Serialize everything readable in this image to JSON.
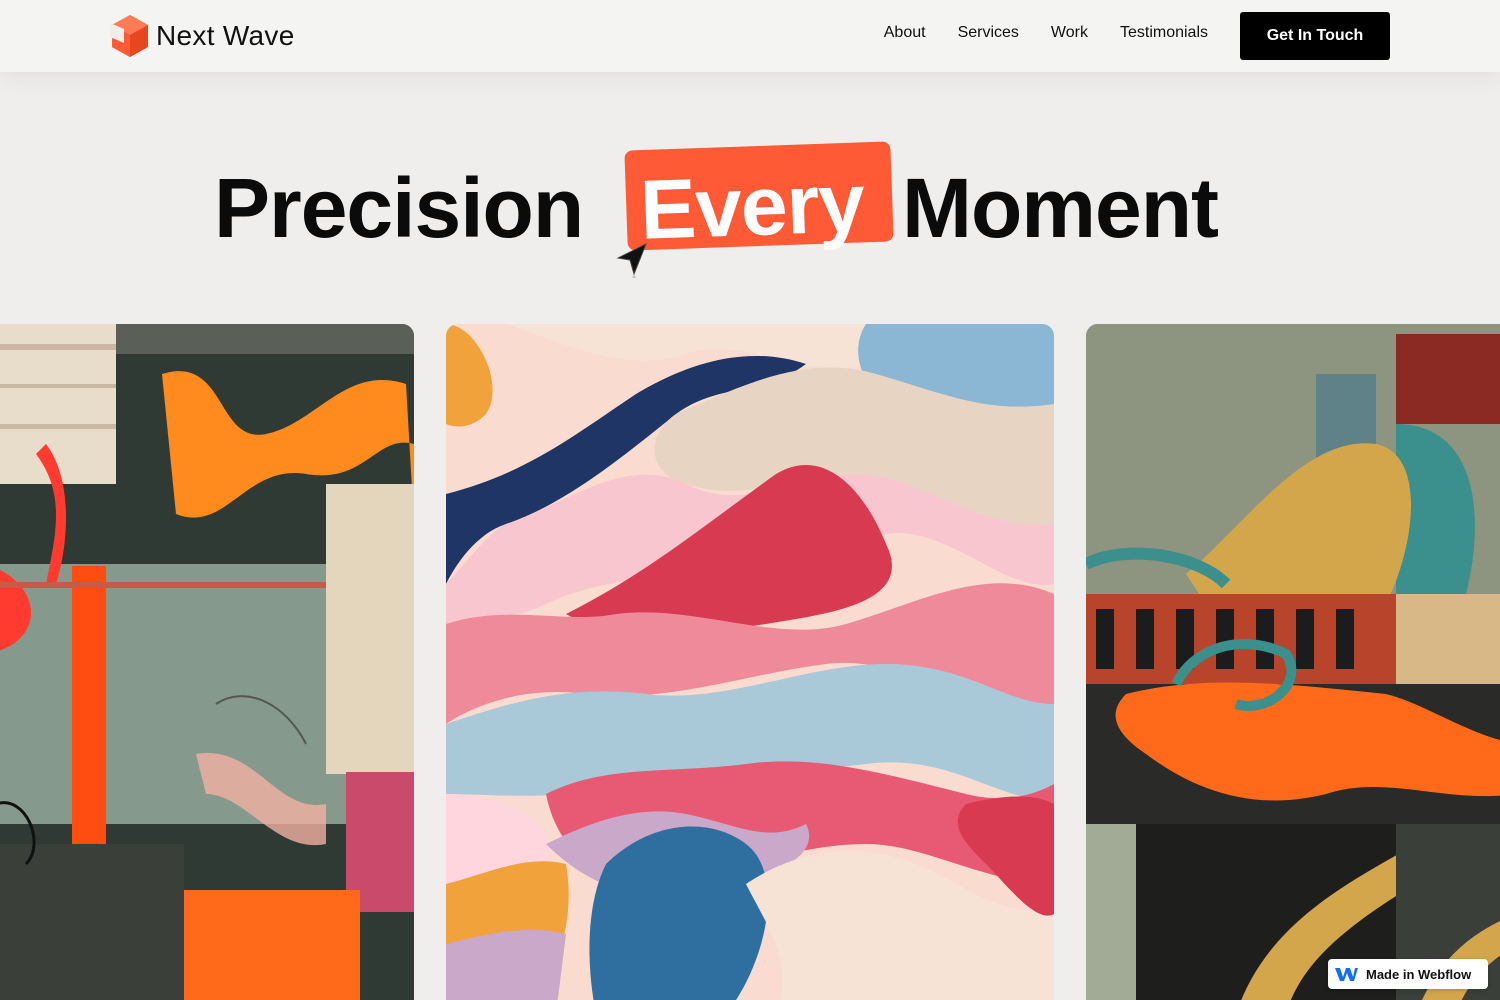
{
  "header": {
    "brand": {
      "name": "Next Wave",
      "logo_icon": "hexagon-cube-icon",
      "logo_color": "#ff5a36"
    },
    "nav": [
      {
        "label": "About"
      },
      {
        "label": "Services"
      },
      {
        "label": "Work"
      },
      {
        "label": "Testimonials"
      }
    ],
    "cta_label": "Get In Touch"
  },
  "hero": {
    "word_1": "Precision",
    "word_2": "Every",
    "word_3": "Moment",
    "highlight_color": "#ff5a36",
    "cursor_icon": "pointer-arrow-icon"
  },
  "gallery": {
    "cards": [
      {
        "name": "abstract-collage-artwork",
        "palette": [
          "#2f3a34",
          "#ff6a1a",
          "#e8dccb",
          "#8fa597"
        ]
      },
      {
        "name": "wavy-pastel-artwork",
        "palette": [
          "#f6d6cf",
          "#1f3566",
          "#e85a73",
          "#aac9d8"
        ]
      },
      {
        "name": "patterned-geometric-artwork",
        "palette": [
          "#6e7a6a",
          "#ff6a1a",
          "#d4a64b",
          "#3b8f8c"
        ]
      }
    ]
  },
  "badge": {
    "label": "Made in Webflow",
    "icon": "webflow-w-icon"
  }
}
